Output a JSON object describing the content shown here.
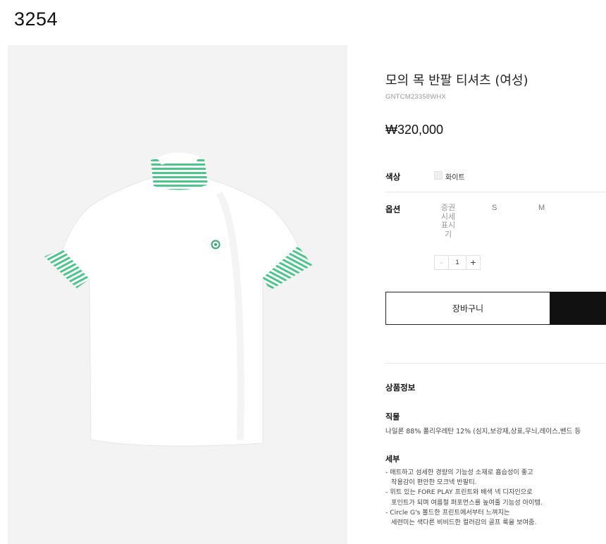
{
  "page_number": "3254",
  "product": {
    "title": "모의 목 반팔 티셔츠 (여성)",
    "sku": "GNTCM23358WHX",
    "price": "₩320,000"
  },
  "options": {
    "color_label": "색상",
    "color_value": "화이트",
    "size_label": "옵션",
    "size_guide": [
      "증권",
      "시세",
      "표시",
      "기"
    ],
    "sizes": [
      "S",
      "M"
    ],
    "quantity": {
      "minus": "-",
      "value": "1",
      "plus": "+"
    }
  },
  "actions": {
    "cart_label": "장바구니"
  },
  "details": {
    "section_title": "상품정보",
    "material_heading": "직물",
    "material_text": "나일론 88% 폴리우레탄 12% (심지,보강재,상표,무늬,레이스,밴드 등",
    "detail_heading": "세부",
    "detail_lines": [
      "- 매트하고 섬세한 경량의 기능성 소재로 흡습성이 좋고",
      "  착용감이 편안한 모크넥 반팔티.",
      "- 위트 있는 FORE PLAY 프린트와 배색 넥 디자인으로",
      "  포인트가 되며 여름철 퍼포먼스를 높여줄 기능성 아이템.",
      "- Circle G's 볼드한 프린트에서부터 느껴지는",
      "  세련미는 색다른 비비드한 컬러감의 골프 룩을 보여줌."
    ]
  },
  "colors": {
    "image_bg": "#f3f3f3",
    "shirt": "#ffffff",
    "stripe_green": "#4cc58a",
    "button_dark": "#111111"
  }
}
